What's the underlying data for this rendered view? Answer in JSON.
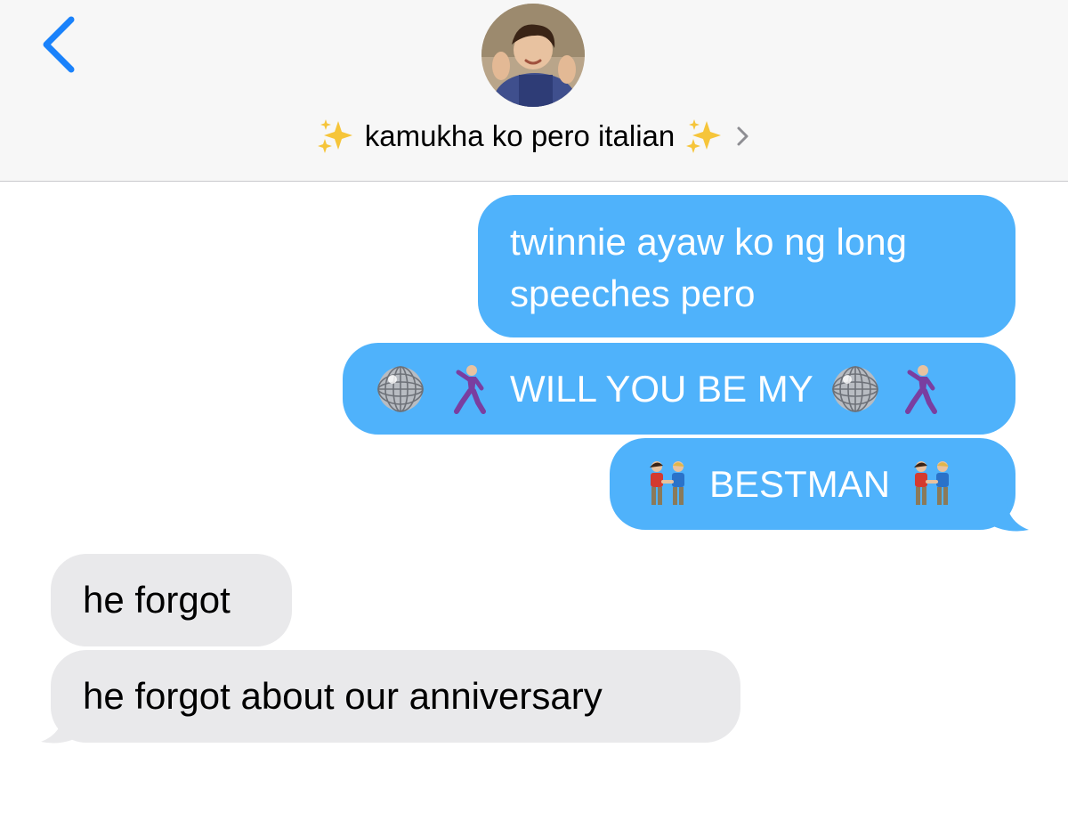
{
  "header": {
    "back_icon": "chevron-left-icon",
    "avatar_icon": "contact-avatar-photo",
    "contact_name": "kamukha ko pero italian",
    "name_decoration_icon": "sparkles-icon",
    "details_icon": "chevron-right-icon"
  },
  "colors": {
    "sent_bubble": "#4fb2fb",
    "received_bubble": "#e9e9eb",
    "accent": "#1a82fb",
    "header_bg": "#f7f7f7"
  },
  "messages": [
    {
      "direction": "sent",
      "text": "twinnie ayaw ko ng long speeches pero"
    },
    {
      "direction": "sent",
      "text": "WILL YOU BE MY",
      "emojis": [
        "mirror-ball-icon",
        "man-dancing-icon"
      ]
    },
    {
      "direction": "sent",
      "text": "BESTMAN",
      "emojis": [
        "men-holding-hands-icon"
      ]
    },
    {
      "direction": "received",
      "text": "he forgot"
    },
    {
      "direction": "received",
      "text": "he forgot about our anniversary"
    }
  ]
}
